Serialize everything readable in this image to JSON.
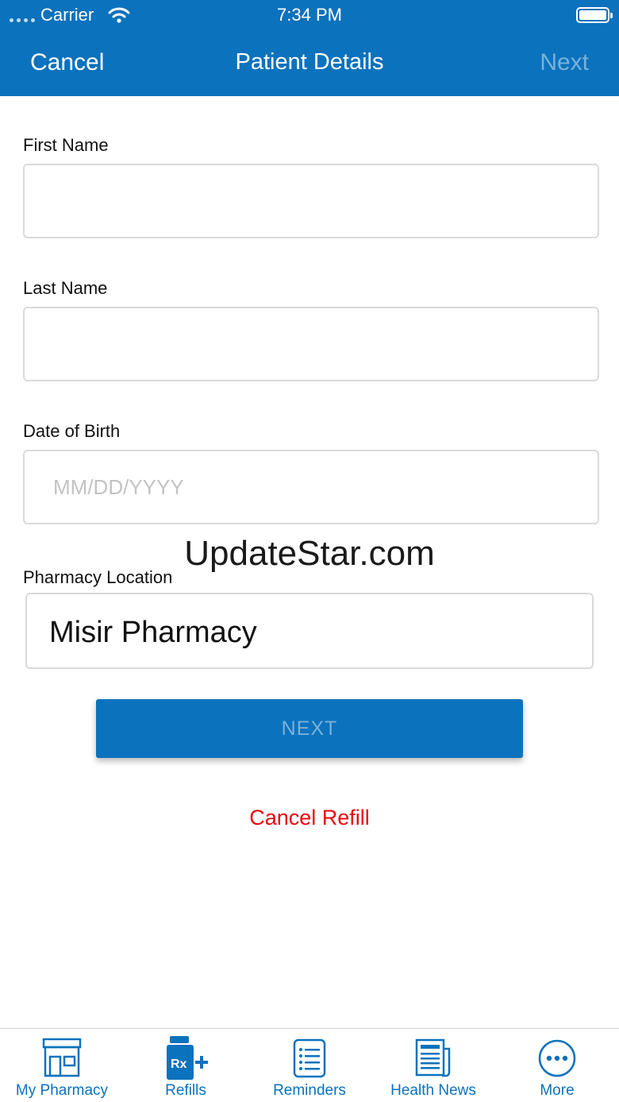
{
  "status_bar": {
    "carrier": "Carrier",
    "time": "7:34 PM"
  },
  "nav": {
    "cancel": "Cancel",
    "title": "Patient Details",
    "next": "Next"
  },
  "form": {
    "first_name": {
      "label": "First Name",
      "value": "",
      "placeholder": ""
    },
    "last_name": {
      "label": "Last Name",
      "value": "",
      "placeholder": ""
    },
    "dob": {
      "label": "Date of Birth",
      "value": "",
      "placeholder": "MM/DD/YYYY"
    },
    "pharmacy": {
      "label": "Pharmacy Location",
      "value": "Misir Pharmacy"
    }
  },
  "watermark": "UpdateStar.com",
  "actions": {
    "next": "NEXT",
    "cancel_refill": "Cancel Refill"
  },
  "tabs": [
    {
      "label": "My Pharmacy",
      "icon": "pharmacy-store-icon"
    },
    {
      "label": "Refills",
      "icon": "rx-refill-icon"
    },
    {
      "label": "Reminders",
      "icon": "reminders-list-icon"
    },
    {
      "label": "Health News",
      "icon": "newspaper-icon"
    },
    {
      "label": "More",
      "icon": "more-icon"
    }
  ],
  "colors": {
    "primary": "#0B72BD",
    "danger": "#E8060C",
    "border": "#DADADA"
  }
}
